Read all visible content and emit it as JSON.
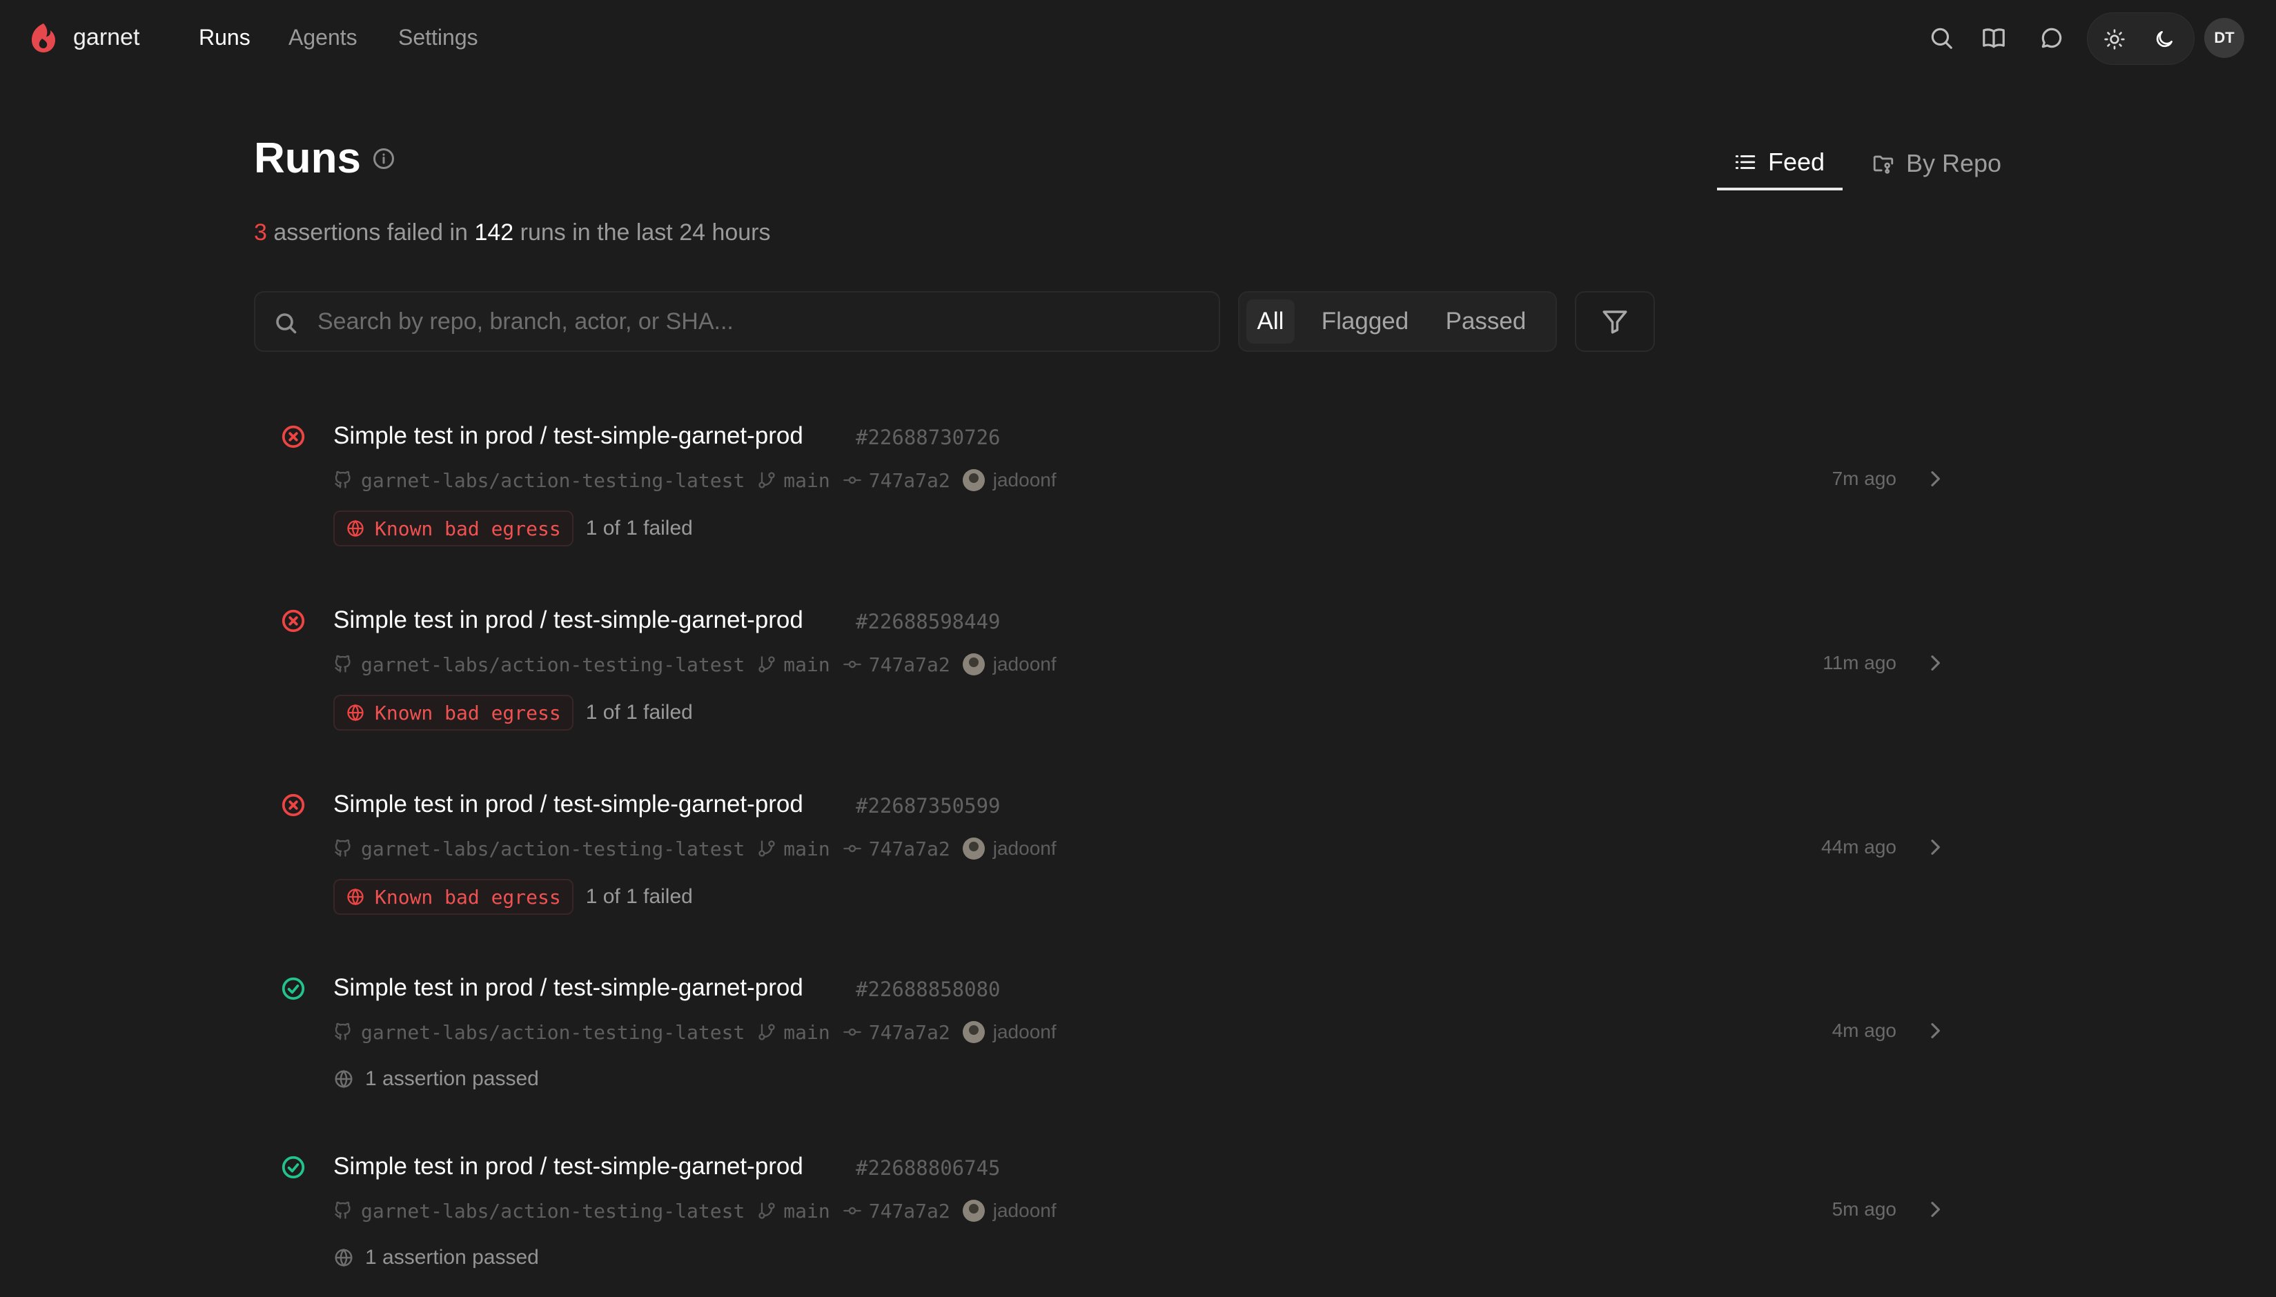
{
  "app": {
    "brand": "garnet"
  },
  "nav": {
    "runs": "Runs",
    "agents": "Agents",
    "settings": "Settings"
  },
  "user": {
    "initials": "DT"
  },
  "header": {
    "title": "Runs",
    "view_tabs": {
      "feed": "Feed",
      "by_repo": "By Repo"
    },
    "summary": {
      "failed_count": "3",
      "text_1": "assertions failed in",
      "runs_count": "142",
      "text_2": "runs in the last 24 hours"
    }
  },
  "search": {
    "placeholder": "Search by repo, branch, actor, or SHA..."
  },
  "filters": {
    "all": "All",
    "flagged": "Flagged",
    "passed": "Passed",
    "selected": "All"
  },
  "runs": [
    {
      "status": "failed",
      "title": "Simple test in prod / test-simple-garnet-prod",
      "id": "#22688730726",
      "repo": "garnet-labs/action-testing-latest",
      "branch": "main",
      "sha": "747a7a2",
      "actor": "jadoonf",
      "time": "7m ago",
      "badge": "Known bad egress",
      "result": "1 of 1 failed"
    },
    {
      "status": "failed",
      "title": "Simple test in prod / test-simple-garnet-prod",
      "id": "#22688598449",
      "repo": "garnet-labs/action-testing-latest",
      "branch": "main",
      "sha": "747a7a2",
      "actor": "jadoonf",
      "time": "11m ago",
      "badge": "Known bad egress",
      "result": "1 of 1 failed"
    },
    {
      "status": "failed",
      "title": "Simple test in prod / test-simple-garnet-prod",
      "id": "#22687350599",
      "repo": "garnet-labs/action-testing-latest",
      "branch": "main",
      "sha": "747a7a2",
      "actor": "jadoonf",
      "time": "44m ago",
      "badge": "Known bad egress",
      "result": "1 of 1 failed"
    },
    {
      "status": "passed",
      "title": "Simple test in prod / test-simple-garnet-prod",
      "id": "#22688858080",
      "repo": "garnet-labs/action-testing-latest",
      "branch": "main",
      "sha": "747a7a2",
      "actor": "jadoonf",
      "time": "4m ago",
      "result": "1 assertion passed"
    },
    {
      "status": "passed",
      "title": "Simple test in prod / test-simple-garnet-prod",
      "id": "#22688806745",
      "repo": "garnet-labs/action-testing-latest",
      "branch": "main",
      "sha": "747a7a2",
      "actor": "jadoonf",
      "time": "5m ago",
      "result": "1 assertion passed"
    }
  ],
  "colors": {
    "background": "#1c1c1c",
    "fail": "#ef4444",
    "pass": "#22c38e",
    "brand": "#e5484d"
  },
  "icons": [
    "garnet-logo-icon",
    "search-icon",
    "book-icon",
    "chat-icon",
    "sun-icon",
    "moon-icon",
    "info-icon",
    "list-icon",
    "folder-git-icon",
    "filter-icon",
    "x-circle-icon",
    "check-circle-icon",
    "github-icon",
    "git-branch-icon",
    "git-commit-icon",
    "globe-icon",
    "chevron-right-icon"
  ]
}
